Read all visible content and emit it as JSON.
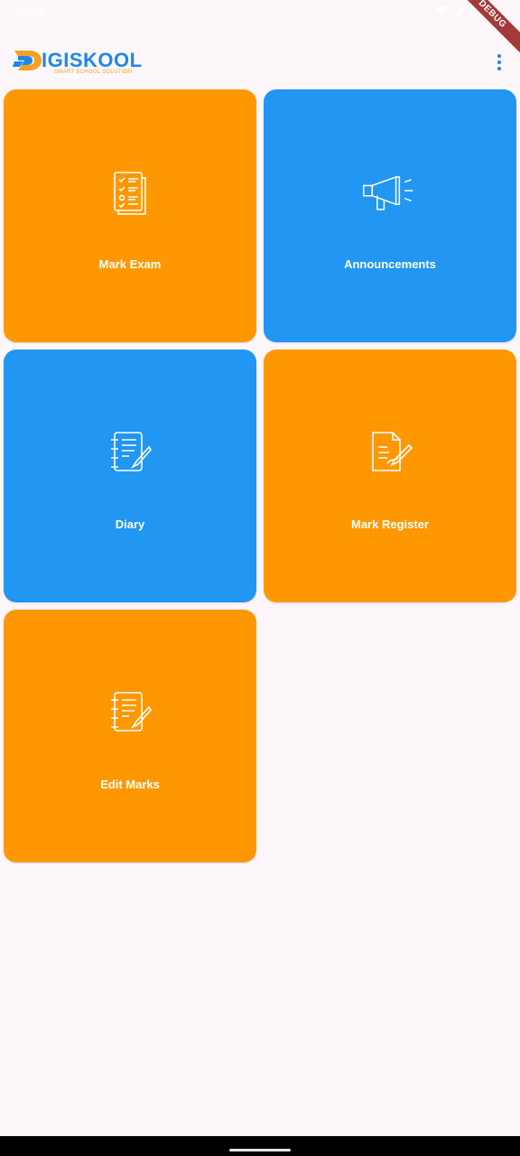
{
  "status_bar": {
    "time": "12:30",
    "battery": "84%"
  },
  "debug_banner": "DEBUG",
  "app_bar": {
    "logo_text": "IGISKOOL",
    "logo_tagline": "SMART SCHOOL SOLUTION",
    "menu_icon": "more-vert-icon"
  },
  "colors": {
    "orange": "#FF9800",
    "blue": "#2196F3",
    "background": "#FDF7FC",
    "brand": "#1E88E5"
  },
  "tiles": [
    {
      "label": "Mark Exam",
      "icon": "exam-checklist-icon",
      "color": "orange"
    },
    {
      "label": "Announcements",
      "icon": "megaphone-icon",
      "color": "blue"
    },
    {
      "label": "Diary",
      "icon": "diary-notebook-icon",
      "color": "blue"
    },
    {
      "label": "Mark Register",
      "icon": "register-sign-icon",
      "color": "orange"
    },
    {
      "label": "Edit Marks",
      "icon": "edit-notebook-icon",
      "color": "orange"
    }
  ]
}
